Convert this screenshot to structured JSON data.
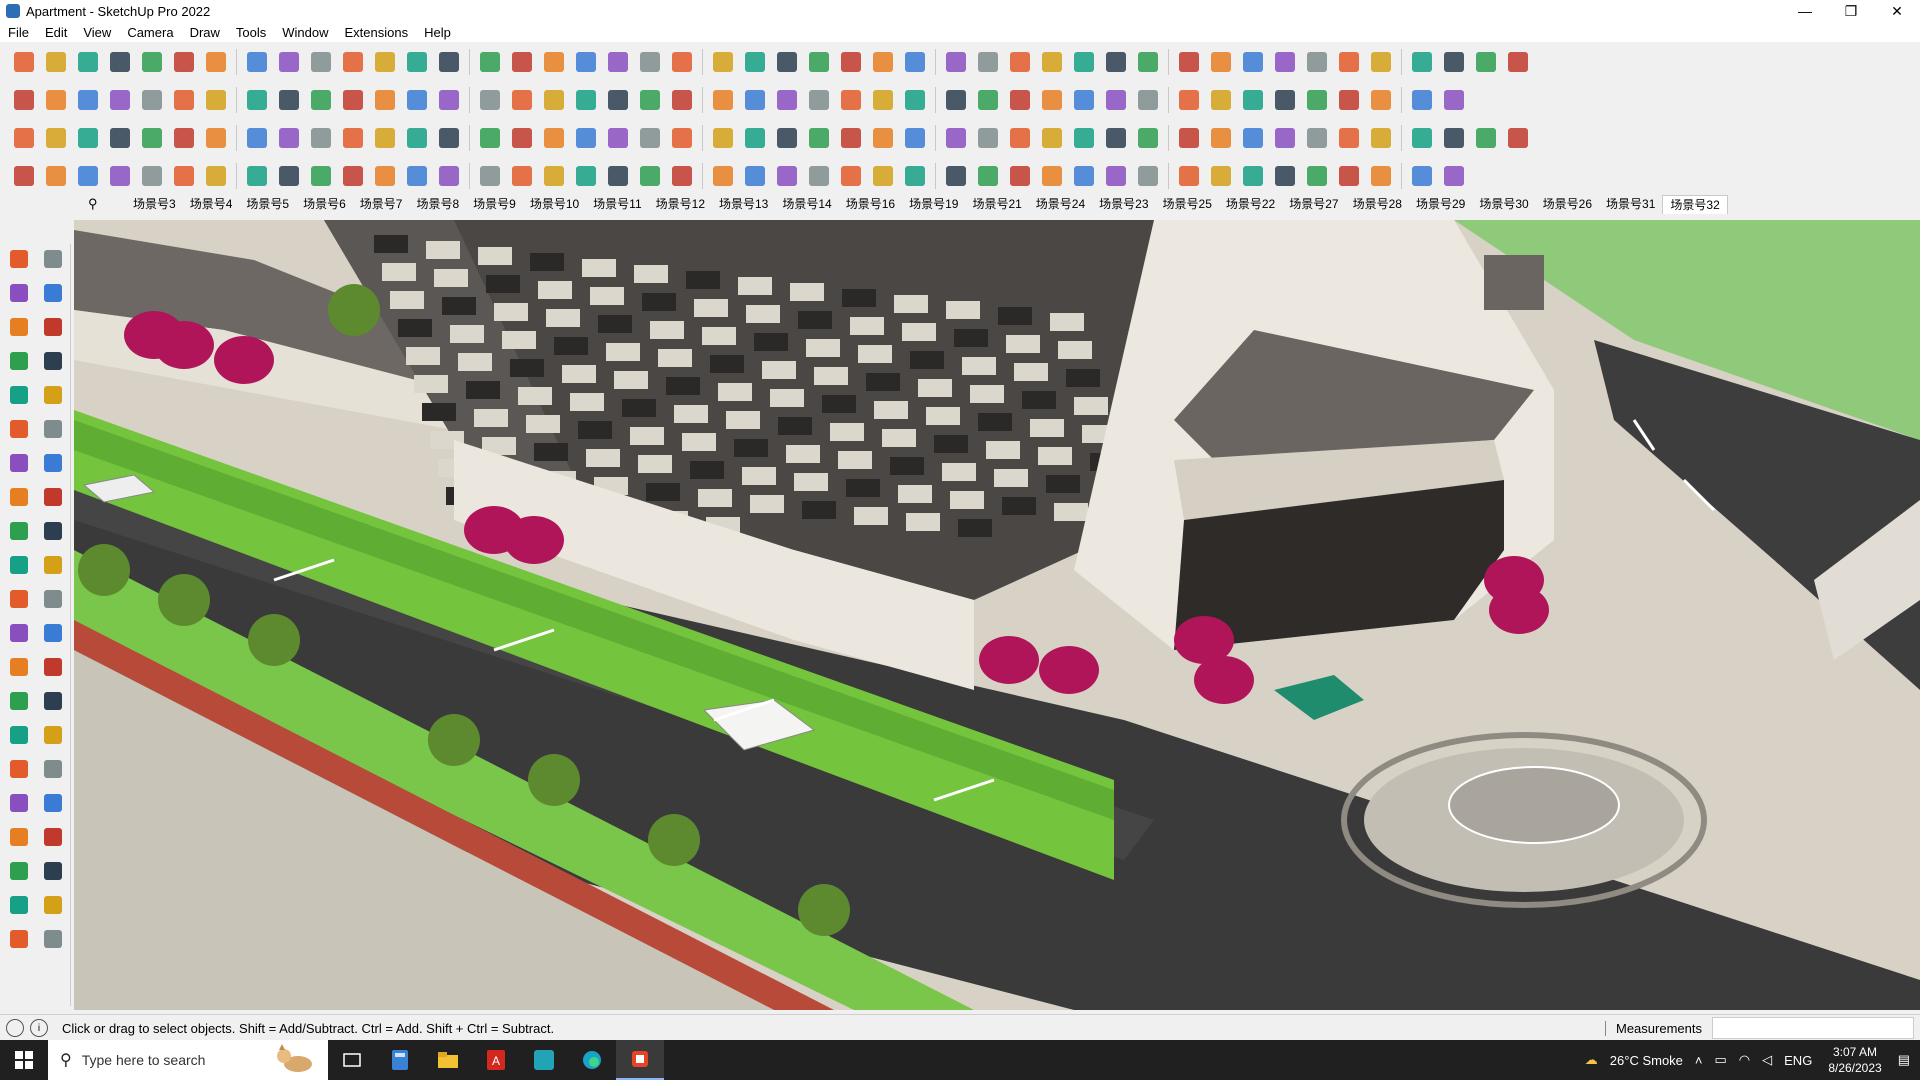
{
  "window": {
    "title": "Apartment - SketchUp Pro 2022",
    "minimize": "—",
    "maximize": "❐",
    "close": "✕"
  },
  "menu": [
    "File",
    "Edit",
    "View",
    "Camera",
    "Draw",
    "Tools",
    "Window",
    "Extensions",
    "Help"
  ],
  "scenes": {
    "tabs": [
      "场景号3",
      "场景号4",
      "场景号5",
      "场景号6",
      "场景号7",
      "场景号8",
      "场景号9",
      "场景号10",
      "场景号11",
      "场景号12",
      "场景号13",
      "场景号14",
      "场景号16",
      "场景号19",
      "场景号21",
      "场景号24",
      "场景号23",
      "场景号25",
      "场景号22",
      "场景号27",
      "场景号28",
      "场景号29",
      "场景号30",
      "场景号26",
      "场景号31",
      "场景号32"
    ],
    "active": "场景号32"
  },
  "status": {
    "hint": "Click or drag to select objects. Shift = Add/Subtract. Ctrl = Add. Shift + Ctrl = Subtract.",
    "measurements_label": "Measurements",
    "measurements_value": ""
  },
  "taskbar": {
    "search_placeholder": "Type here to search",
    "weather": "26°C  Smoke",
    "lang": "ENG",
    "time": "3:07 AM",
    "date": "8/26/2023"
  },
  "colors": {
    "accent": "#0078d4",
    "umbrella": "#b0155a",
    "grass": "#7fc94a",
    "road": "#3a3a3a"
  }
}
